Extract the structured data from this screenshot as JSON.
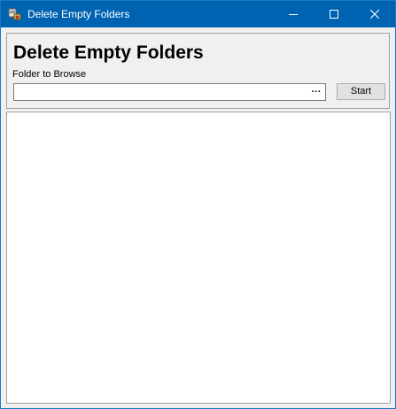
{
  "window": {
    "title": "Delete Empty Folders",
    "app_icon": "delete-folder-app-icon",
    "controls": {
      "minimize_icon": "minimize-icon",
      "maximize_icon": "maximize-icon",
      "close_icon": "close-icon"
    },
    "accent_color": "#0063b1"
  },
  "header": {
    "heading": "Delete Empty Folders",
    "folder_label": "Folder to Browse",
    "folder_value": "",
    "browse_label": "···",
    "start_label": "Start"
  },
  "output": {
    "content": ""
  }
}
